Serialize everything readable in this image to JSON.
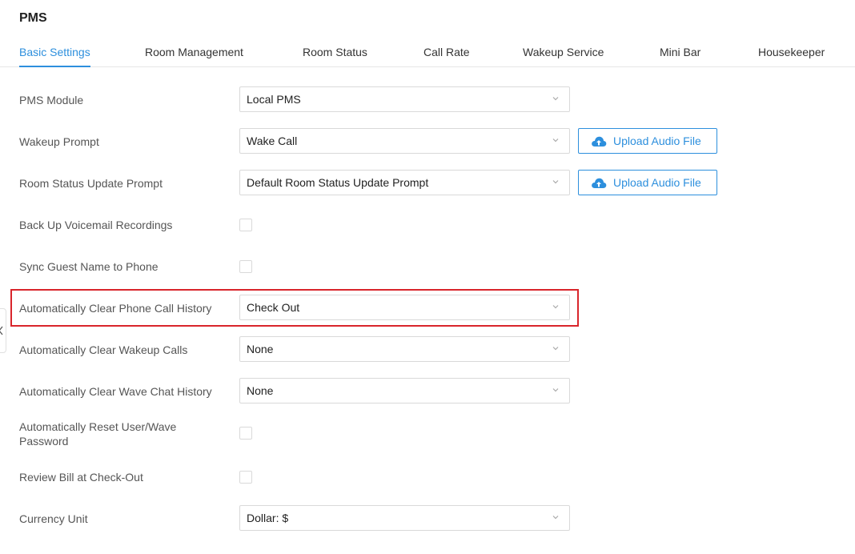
{
  "page": {
    "title": "PMS"
  },
  "tabs": [
    {
      "label": "Basic Settings",
      "active": true
    },
    {
      "label": "Room Management",
      "active": false
    },
    {
      "label": "Room Status",
      "active": false
    },
    {
      "label": "Call Rate",
      "active": false
    },
    {
      "label": "Wakeup Service",
      "active": false
    },
    {
      "label": "Mini Bar",
      "active": false
    },
    {
      "label": "Housekeeper",
      "active": false
    }
  ],
  "form": {
    "pms_module": {
      "label": "PMS Module",
      "value": "Local PMS"
    },
    "wakeup_prompt": {
      "label": "Wakeup Prompt",
      "value": "Wake Call",
      "button": "Upload Audio File"
    },
    "room_status_prompt": {
      "label": "Room Status Update Prompt",
      "value": "Default Room Status Update Prompt",
      "button": "Upload Audio File"
    },
    "backup_voicemail": {
      "label": "Back Up Voicemail Recordings",
      "checked": false
    },
    "sync_guest_name": {
      "label": "Sync Guest Name to Phone",
      "checked": false
    },
    "clear_call_history": {
      "label": "Automatically Clear Phone Call History",
      "value": "Check Out"
    },
    "clear_wakeup_calls": {
      "label": "Automatically Clear Wakeup Calls",
      "value": "None"
    },
    "clear_wave_chat": {
      "label": "Automatically Clear Wave Chat History",
      "value": "None"
    },
    "reset_password": {
      "label": "Automatically Reset User/Wave Password",
      "checked": false
    },
    "review_bill": {
      "label": "Review Bill at Check-Out",
      "checked": false
    },
    "currency_unit": {
      "label": "Currency Unit",
      "value": "Dollar: $"
    }
  },
  "colors": {
    "accent": "#2d8fdd",
    "highlight": "#d9252b",
    "border": "#d9d9d9"
  },
  "icons": {
    "upload": "cloud-upload-icon",
    "dropdown": "chevron-down-icon",
    "collapse": "chevron-left-icon"
  }
}
